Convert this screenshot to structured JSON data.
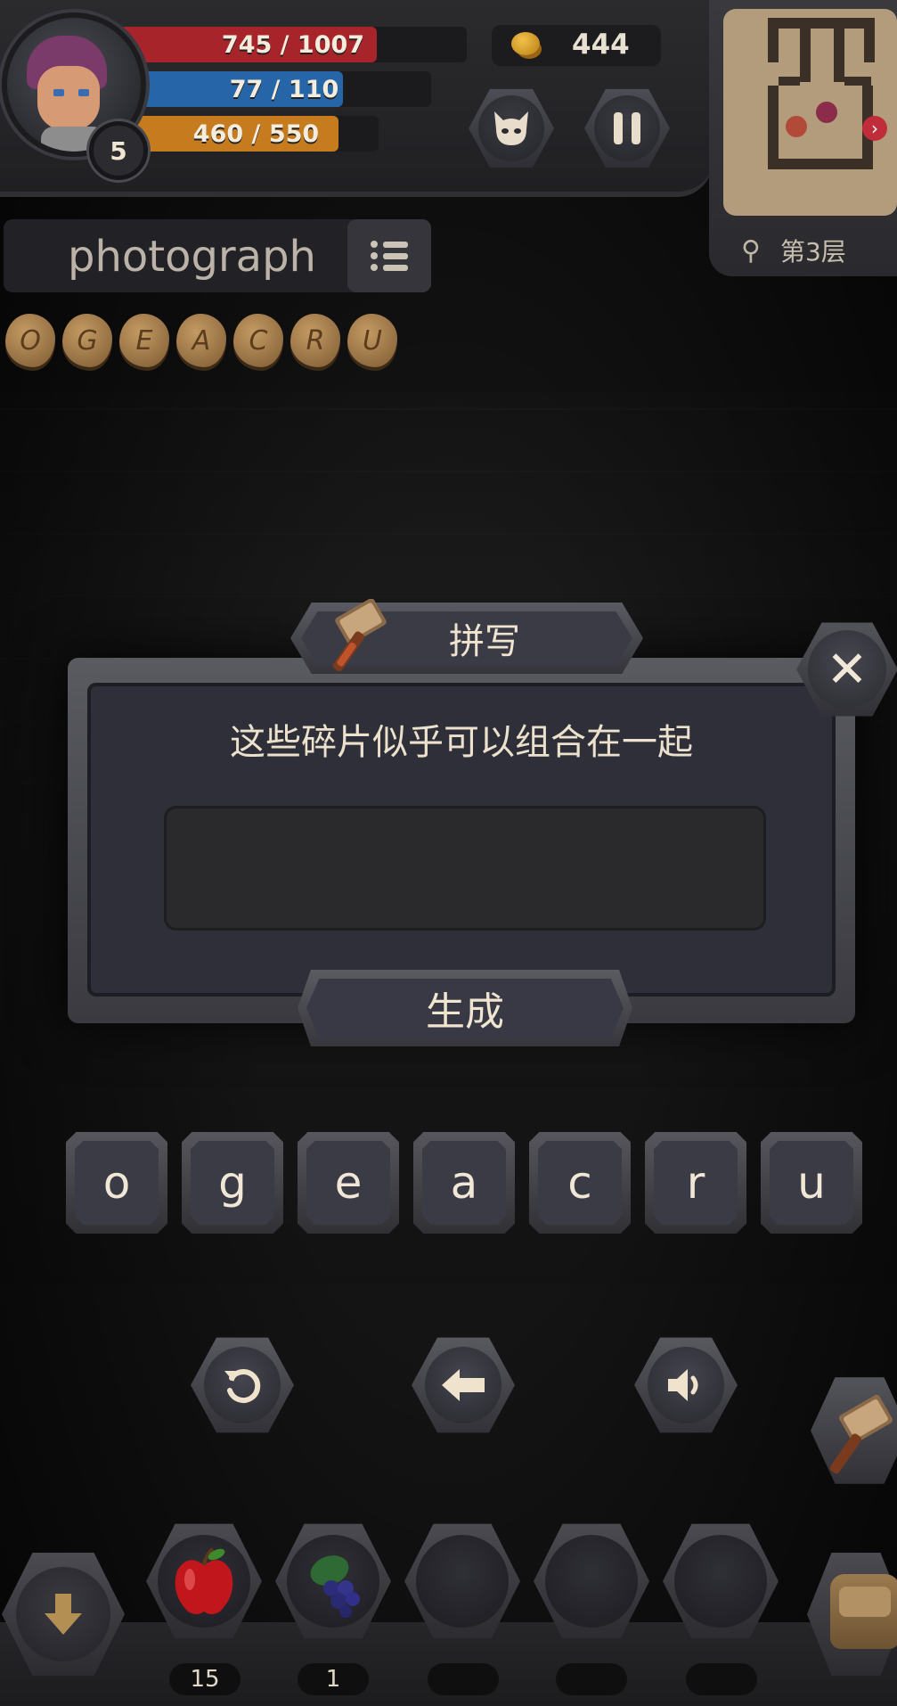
{
  "hud": {
    "level": "5",
    "hp": {
      "text": "745 / 1007",
      "current": 745,
      "max": 1007,
      "color": "#a8242b"
    },
    "mp": {
      "text": "77 / 110",
      "current": 77,
      "max": 110,
      "color": "#2666a8"
    },
    "xp": {
      "text": "460 / 550",
      "current": 460,
      "max": 550,
      "color": "#c77b1f"
    },
    "gold": "444",
    "monster_icon": "monster-face-icon",
    "pause_icon": "pause-icon"
  },
  "minimap": {
    "floor_label": "第3层",
    "search_icon": "magnifier-icon"
  },
  "word_hint": {
    "word": "photograph",
    "list_icon": "list-icon"
  },
  "fragments": [
    "O",
    "G",
    "E",
    "A",
    "C",
    "R",
    "U"
  ],
  "dialog": {
    "title": "拼写",
    "message": "这些碎片似乎可以组合在一起",
    "answer": "",
    "generate_label": "生成",
    "close_icon": "close-icon",
    "title_icon": "hammer-icon"
  },
  "letters": [
    "o",
    "g",
    "e",
    "a",
    "c",
    "r",
    "u"
  ],
  "controls": {
    "reset_icon": "reset-icon",
    "backspace_icon": "backspace-arrow-icon",
    "sound_icon": "speaker-icon",
    "side_tool_icon": "hammer-icon"
  },
  "inventory": {
    "down_icon": "down-arrow-icon",
    "bag_icon": "bag-icon",
    "slots": [
      {
        "item": "apple-icon",
        "count": "15"
      },
      {
        "item": "grapes-icon",
        "count": "1"
      },
      {
        "item": "",
        "count": ""
      },
      {
        "item": "",
        "count": ""
      },
      {
        "item": "",
        "count": ""
      }
    ]
  }
}
